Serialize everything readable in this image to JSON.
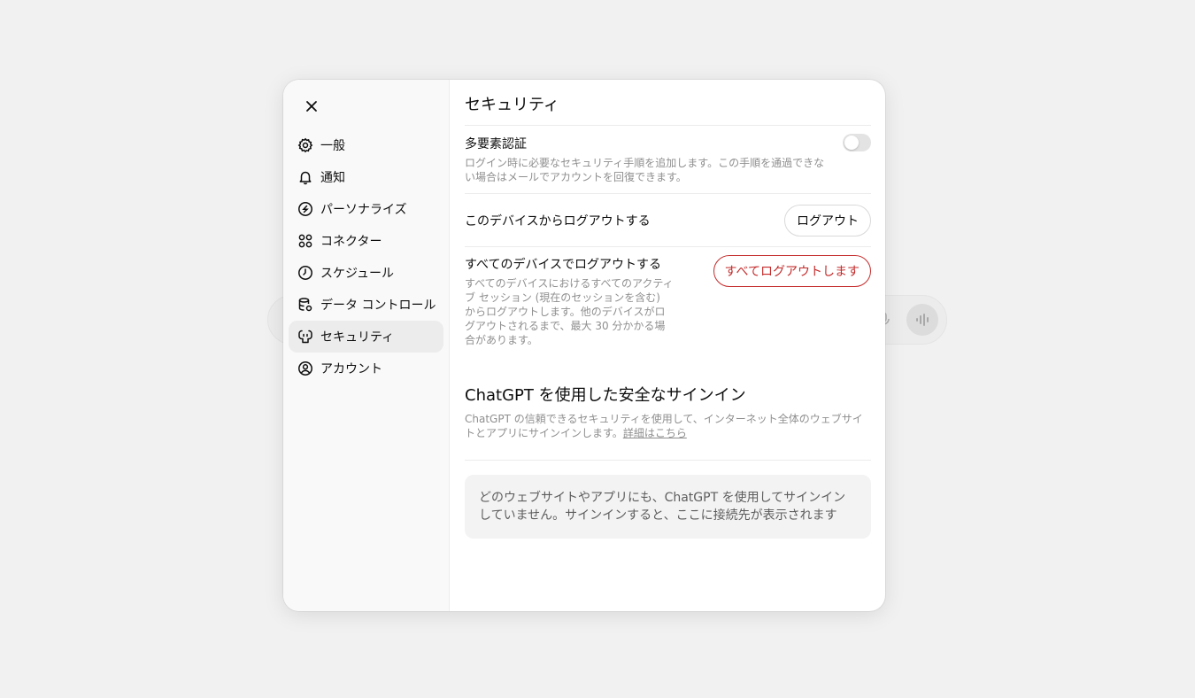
{
  "sidebar": {
    "close_icon": "close-icon",
    "items": [
      {
        "label": "一般",
        "icon": "gear-icon"
      },
      {
        "label": "通知",
        "icon": "bell-icon"
      },
      {
        "label": "パーソナライズ",
        "icon": "personalize-icon"
      },
      {
        "label": "コネクター",
        "icon": "connectors-icon"
      },
      {
        "label": "スケジュール",
        "icon": "clock-icon"
      },
      {
        "label": "データ コントロール",
        "icon": "database-gear-icon"
      },
      {
        "label": "セキュリティ",
        "icon": "shield-icon",
        "active": true
      },
      {
        "label": "アカウント",
        "icon": "account-icon"
      }
    ]
  },
  "main": {
    "title": "セキュリティ",
    "mfa": {
      "label": "多要素認証",
      "description": "ログイン時に必要なセキュリティ手順を追加します。この手順を通過できない場合はメールでアカウントを回復できます。",
      "enabled": false
    },
    "logout_device": {
      "label": "このデバイスからログアウトする",
      "button": "ログアウト"
    },
    "logout_all": {
      "label": "すべてのデバイスでログアウトする",
      "description": "すべてのデバイスにおけるすべてのアクティブ セッション (現在のセッションを含む) からログアウトします。他のデバイスがログアウトされるまで、最大 30 分かかる場合があります。",
      "button": "すべてログアウトします"
    },
    "secure_signin": {
      "title": "ChatGPT を使用した安全なサインイン",
      "description": "ChatGPT の信頼できるセキュリティを使用して、インターネット全体のウェブサイトとアプリにサインインします。",
      "link": "詳細はこちら",
      "empty_message": "どのウェブサイトやアプリにも、ChatGPT を使用してサインインしていません。サインインすると、ここに接続先が表示されます"
    }
  },
  "colors": {
    "danger": "#c42b2b",
    "active_nav": "#ececec",
    "sidebar_bg": "#f9f9f9"
  }
}
